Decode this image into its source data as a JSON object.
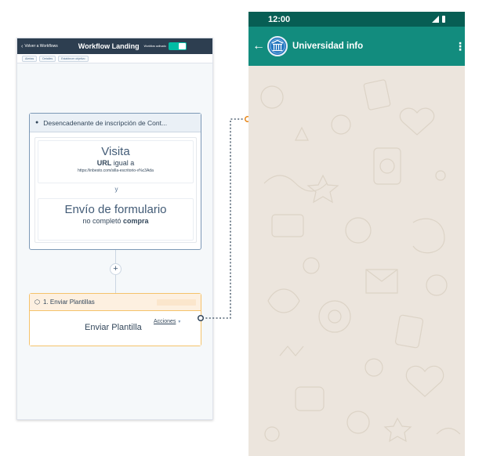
{
  "workflow": {
    "back_label": "Volver a Workflows",
    "title": "Workflow Landing",
    "status_label": "Workflow activado",
    "tabs": [
      {
        "label": "Alertas"
      },
      {
        "label": "Detalles"
      },
      {
        "label": "Establecer objetivo"
      }
    ],
    "trigger": {
      "title": "Desencadenante de inscripción de Cont...",
      "visit": {
        "title": "Visita",
        "condition_bold": "URL",
        "condition_text": " igual a",
        "url": "https://inbesto.com/silla-escritorio-v%c3Ada"
      },
      "and_label": "y",
      "form": {
        "title": "Envío de formulario",
        "condition_text": "no completó ",
        "condition_bold": "compra"
      }
    },
    "add_symbol": "+",
    "action": {
      "title": "1. Enviar Plantillas",
      "label": "Enviar Plantilla",
      "menu_label": "Acciones"
    }
  },
  "phone": {
    "time": "12:00",
    "contact_name": "Universidad info",
    "back_symbol": "←",
    "more_symbol": "⋮"
  },
  "colors": {
    "workflow_header": "#2d3e50",
    "toggle_on": "#00bda5",
    "action_border": "#f5c26b",
    "connector_dot": "#e8891d",
    "whatsapp_dark": "#075e54",
    "whatsapp_teal": "#128c7e",
    "chat_background": "#ece5dd"
  },
  "icons": {
    "back": "chevron-left-icon",
    "trigger": "person-icon",
    "action": "cube-icon",
    "menu_caret": "caret-down-icon",
    "signal": "signal-icon",
    "battery": "battery-icon",
    "avatar": "university-logo-icon"
  }
}
